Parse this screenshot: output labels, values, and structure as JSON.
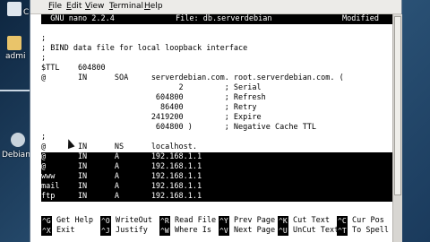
{
  "desktop": {
    "icons": [
      {
        "label": "C",
        "name": "computer-desktop-icon"
      },
      {
        "label": "admi",
        "name": "home-folder-desktop-icon"
      },
      {
        "label": "Debian",
        "name": "debian-desktop-icon"
      }
    ]
  },
  "menu": {
    "items": [
      {
        "mnemonic": "F",
        "rest": "ile"
      },
      {
        "mnemonic": "E",
        "rest": "dit"
      },
      {
        "mnemonic": "V",
        "rest": "iew"
      },
      {
        "mnemonic": "T",
        "rest": "erminal"
      },
      {
        "mnemonic": "H",
        "rest": "elp"
      }
    ]
  },
  "nano": {
    "version": "  GNU nano 2.2.4",
    "file": "File: db.serverdebian",
    "status": "Modified  "
  },
  "lines": [
    ";",
    "; BIND data file for local loopback interface",
    ";",
    "$TTL    604800",
    "@       IN      SOA     serverdebian.com. root.serverdebian.com. (",
    "                              2         ; Serial",
    "                         604800         ; Refresh",
    "                          86400         ; Retry",
    "                        2419200         ; Expire",
    "                         604800 )       ; Negative Cache TTL",
    ";",
    "@       IN      NS      localhost.",
    "@       IN      A       192.168.1.1",
    "@       IN      A       192.168.1.1",
    "www     IN      A       192.168.1.1",
    "mail    IN      A       192.168.1.1",
    "ftp     IN      A       192.168.1.1"
  ],
  "shortcuts": {
    "row1": [
      {
        "key": "^G",
        "label": "Get Help"
      },
      {
        "key": "^O",
        "label": "WriteOut"
      },
      {
        "key": "^R",
        "label": "Read File"
      },
      {
        "key": "^Y",
        "label": "Prev Page"
      },
      {
        "key": "^K",
        "label": "Cut Text"
      },
      {
        "key": "^C",
        "label": "Cur Pos"
      }
    ],
    "row2": [
      {
        "key": "^X",
        "label": "Exit"
      },
      {
        "key": "^J",
        "label": "Justify"
      },
      {
        "key": "^W",
        "label": "Where Is"
      },
      {
        "key": "^V",
        "label": "Next Page"
      },
      {
        "key": "^U",
        "label": "UnCut Text"
      },
      {
        "key": "^T",
        "label": "To Spell"
      }
    ]
  }
}
